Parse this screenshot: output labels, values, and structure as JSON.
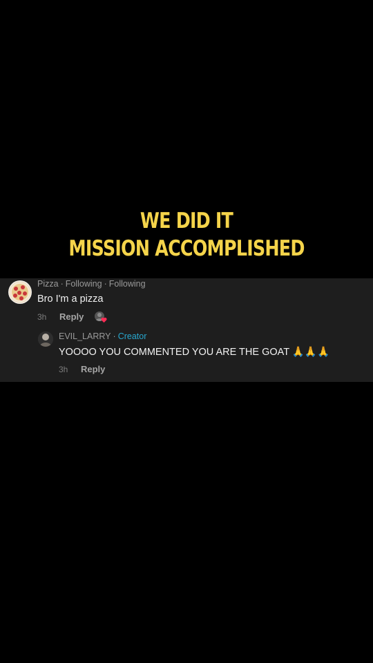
{
  "caption": {
    "line1": "WE DID IT",
    "line2": "MISSION ACCOMPLISHED",
    "color": "#f5d44a"
  },
  "comment": {
    "username": "Pizza",
    "separator": "·",
    "tag1": "Following",
    "tag2": "Following",
    "text": "Bro I'm a pizza",
    "time": "3h",
    "reply_label": "Reply",
    "avatar_icon": "pizza-icon",
    "liked_by_creator_icon": "creator-like-heart-icon"
  },
  "reply": {
    "username": "EVIL_LARRY",
    "separator": "·",
    "badge": "Creator",
    "badge_color": "#28a8cf",
    "text": "YOOOO YOU COMMENTED YOU ARE THE GOAT",
    "emoji": "🙏🙏🙏",
    "time": "3h",
    "reply_label": "Reply",
    "avatar_icon": "user-avatar"
  }
}
